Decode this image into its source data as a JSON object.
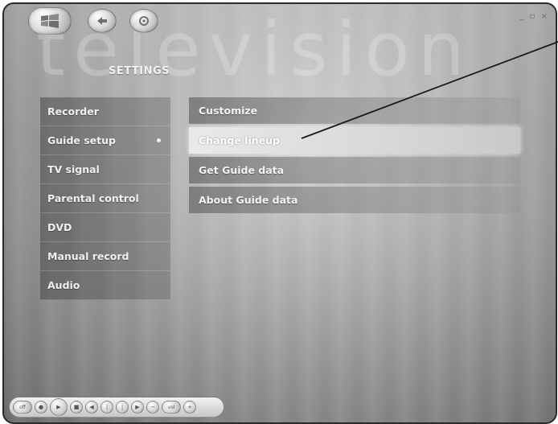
{
  "window": {
    "watermark_text": "television",
    "controls_text": "_ ▫ ×"
  },
  "page": {
    "title": "SETTINGS"
  },
  "left_menu": {
    "items": [
      {
        "label": "Recorder"
      },
      {
        "label": "Guide setup",
        "selected": true
      },
      {
        "label": "TV signal"
      },
      {
        "label": "Parental control"
      },
      {
        "label": "DVD"
      },
      {
        "label": "Manual record"
      },
      {
        "label": "Audio"
      }
    ]
  },
  "right_menu": {
    "items": [
      {
        "label": "Customize"
      },
      {
        "label": "Change lineup",
        "focused": true
      },
      {
        "label": "Get Guide data"
      },
      {
        "label": "About Guide data"
      }
    ]
  },
  "transport": {
    "left_label": "off",
    "right_label": "vol"
  },
  "icons": {
    "start": "windows-media-center-start-icon",
    "back": "back-arrow-icon",
    "home": "home-icon"
  }
}
